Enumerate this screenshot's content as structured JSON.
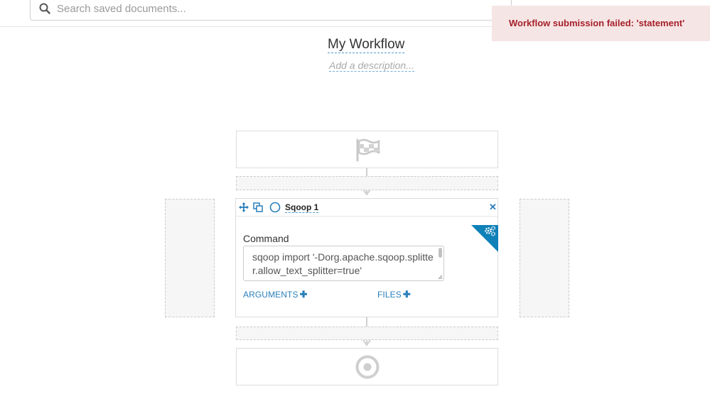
{
  "search": {
    "placeholder": "Search saved documents..."
  },
  "notification": {
    "message": "Workflow submission failed: 'statement'"
  },
  "workflow": {
    "title": "My Workflow",
    "description_placeholder": "Add a description..."
  },
  "action": {
    "name": "Sqoop 1",
    "command_label": "Command",
    "command_value": "sqoop import '-Dorg.apache.sqoop.splitter.allow_text_splitter=true'",
    "arguments_label": "ARGUMENTS",
    "files_label": "FILES",
    "close_glyph": "✕"
  },
  "icons": {
    "search": "search-icon",
    "start": "flag-checkered-icon",
    "move": "arrows-move-icon",
    "copy": "copy-icon",
    "status": "circle-status-icon",
    "close": "close-icon",
    "settings": "gears-icon",
    "end": "bullseye-icon"
  },
  "colors": {
    "accent": "#2a7fba",
    "corner": "#0f80b8",
    "error_bg": "#f6e5e5",
    "error_text": "#a5202a"
  }
}
